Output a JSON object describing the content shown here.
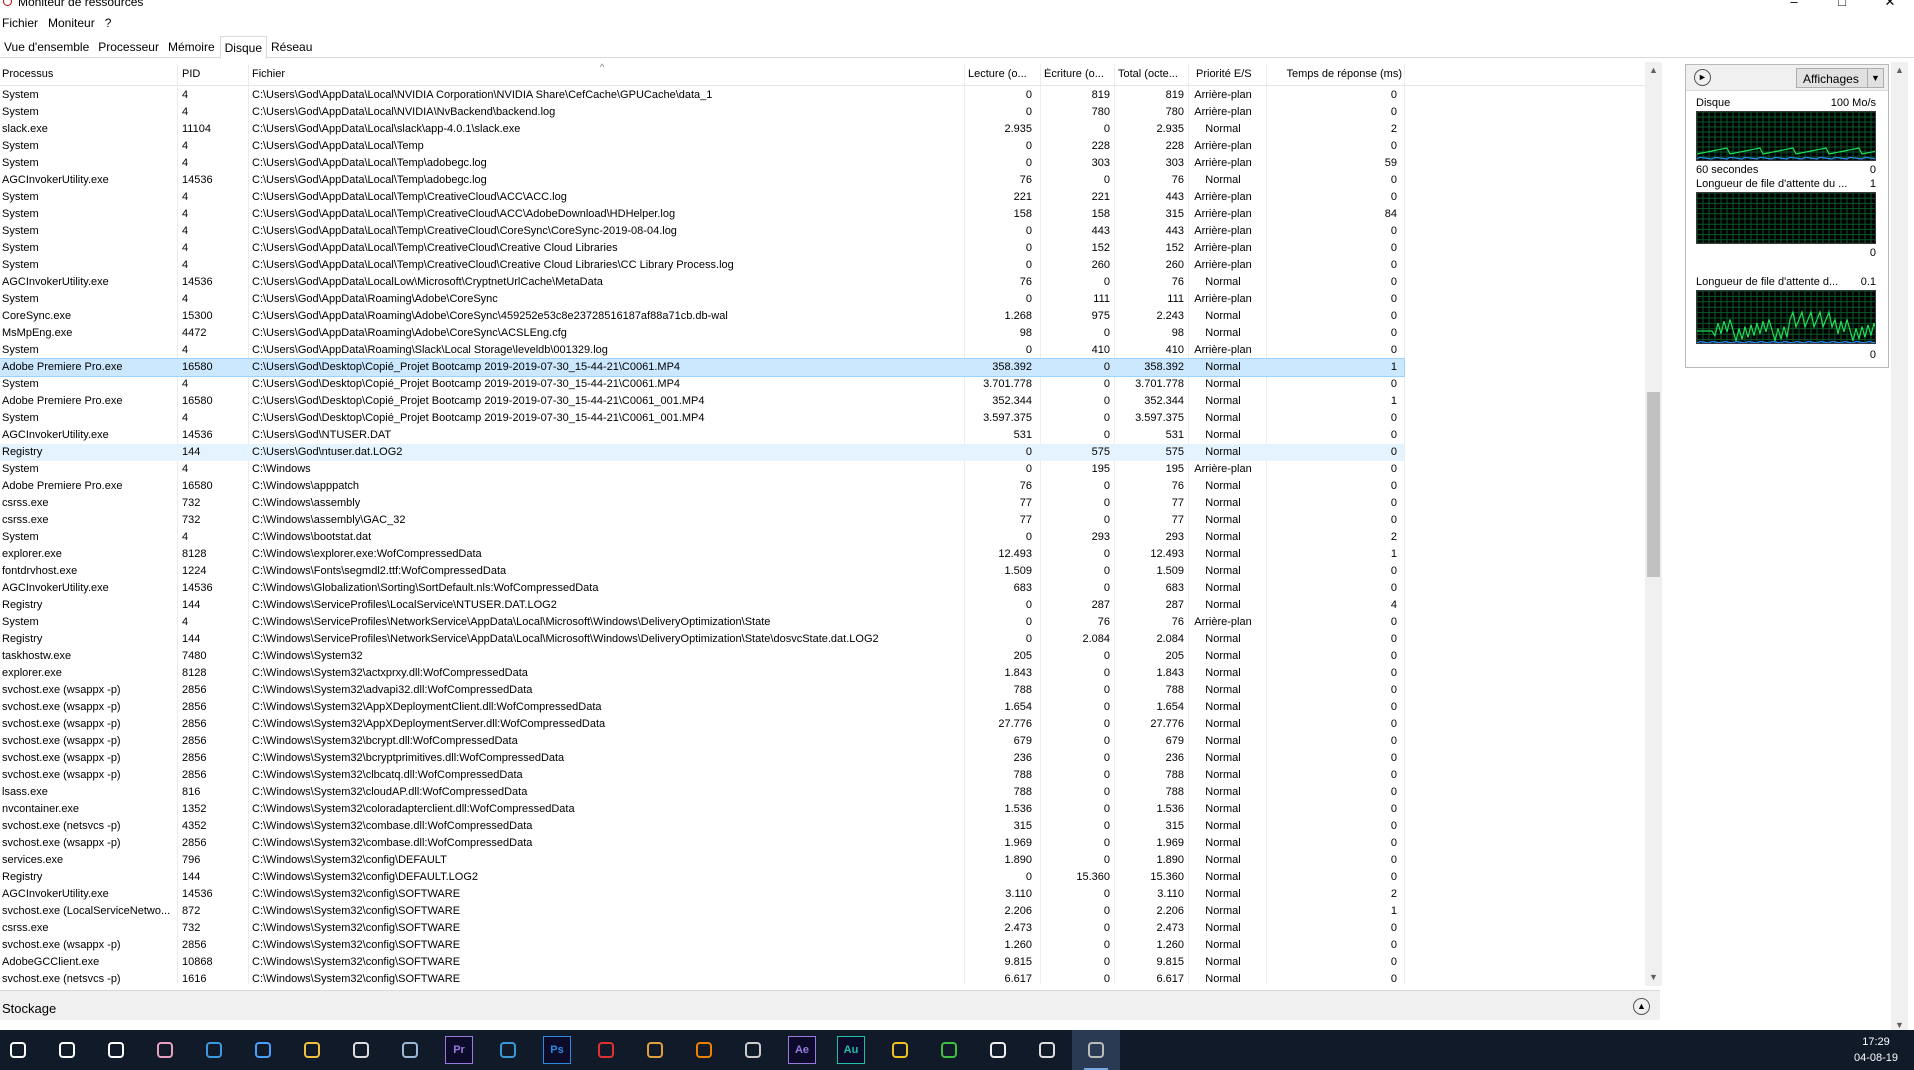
{
  "window": {
    "title": "Moniteur de ressources",
    "controls": [
      "–",
      "□",
      "✕"
    ]
  },
  "menu": [
    "Fichier",
    "Moniteur",
    "?"
  ],
  "tabs": [
    "Vue d'ensemble",
    "Processeur",
    "Mémoire",
    "Disque",
    "Réseau"
  ],
  "active_tab": "Disque",
  "columns": [
    "Processus",
    "PID",
    "Fichier",
    "Lecture (o...",
    "Écriture (o...",
    "Total (octe...",
    "Priorité E/S",
    "Temps de réponse (ms)"
  ],
  "rows": [
    [
      "System",
      "4",
      "C:\\Users\\God\\AppData\\Local\\NVIDIA Corporation\\NVIDIA Share\\CefCache\\GPUCache\\data_1",
      "0",
      "819",
      "819",
      "Arrière-plan",
      "0"
    ],
    [
      "System",
      "4",
      "C:\\Users\\God\\AppData\\Local\\NVIDIA\\NvBackend\\backend.log",
      "0",
      "780",
      "780",
      "Arrière-plan",
      "0"
    ],
    [
      "slack.exe",
      "11104",
      "C:\\Users\\God\\AppData\\Local\\slack\\app-4.0.1\\slack.exe",
      "2.935",
      "0",
      "2.935",
      "Normal",
      "2"
    ],
    [
      "System",
      "4",
      "C:\\Users\\God\\AppData\\Local\\Temp",
      "0",
      "228",
      "228",
      "Arrière-plan",
      "0"
    ],
    [
      "System",
      "4",
      "C:\\Users\\God\\AppData\\Local\\Temp\\adobegc.log",
      "0",
      "303",
      "303",
      "Arrière-plan",
      "59"
    ],
    [
      "AGCInvokerUtility.exe",
      "14536",
      "C:\\Users\\God\\AppData\\Local\\Temp\\adobegc.log",
      "76",
      "0",
      "76",
      "Normal",
      "0"
    ],
    [
      "System",
      "4",
      "C:\\Users\\God\\AppData\\Local\\Temp\\CreativeCloud\\ACC\\ACC.log",
      "221",
      "221",
      "443",
      "Arrière-plan",
      "0"
    ],
    [
      "System",
      "4",
      "C:\\Users\\God\\AppData\\Local\\Temp\\CreativeCloud\\ACC\\AdobeDownload\\HDHelper.log",
      "158",
      "158",
      "315",
      "Arrière-plan",
      "84"
    ],
    [
      "System",
      "4",
      "C:\\Users\\God\\AppData\\Local\\Temp\\CreativeCloud\\CoreSync\\CoreSync-2019-08-04.log",
      "0",
      "443",
      "443",
      "Arrière-plan",
      "0"
    ],
    [
      "System",
      "4",
      "C:\\Users\\God\\AppData\\Local\\Temp\\CreativeCloud\\Creative Cloud Libraries",
      "0",
      "152",
      "152",
      "Arrière-plan",
      "0"
    ],
    [
      "System",
      "4",
      "C:\\Users\\God\\AppData\\Local\\Temp\\CreativeCloud\\Creative Cloud Libraries\\CC Library Process.log",
      "0",
      "260",
      "260",
      "Arrière-plan",
      "0"
    ],
    [
      "AGCInvokerUtility.exe",
      "14536",
      "C:\\Users\\God\\AppData\\LocalLow\\Microsoft\\CryptnetUrlCache\\MetaData",
      "76",
      "0",
      "76",
      "Normal",
      "0"
    ],
    [
      "System",
      "4",
      "C:\\Users\\God\\AppData\\Roaming\\Adobe\\CoreSync",
      "0",
      "111",
      "111",
      "Arrière-plan",
      "0"
    ],
    [
      "CoreSync.exe",
      "15300",
      "C:\\Users\\God\\AppData\\Roaming\\Adobe\\CoreSync\\459252e53c8e23728516187af88a71cb.db-wal",
      "1.268",
      "975",
      "2.243",
      "Normal",
      "0"
    ],
    [
      "MsMpEng.exe",
      "4472",
      "C:\\Users\\God\\AppData\\Roaming\\Adobe\\CoreSync\\ACSLEng.cfg",
      "98",
      "0",
      "98",
      "Normal",
      "0"
    ],
    [
      "System",
      "4",
      "C:\\Users\\God\\AppData\\Roaming\\Slack\\Local Storage\\leveldb\\001329.log",
      "0",
      "410",
      "410",
      "Arrière-plan",
      "0"
    ],
    [
      "Adobe Premiere Pro.exe",
      "16580",
      "C:\\Users\\God\\Desktop\\Copié_Projet Bootcamp 2019-2019-07-30_15-44-21\\C0061.MP4",
      "358.392",
      "0",
      "358.392",
      "Normal",
      "1"
    ],
    [
      "System",
      "4",
      "C:\\Users\\God\\Desktop\\Copié_Projet Bootcamp 2019-2019-07-30_15-44-21\\C0061.MP4",
      "3.701.778",
      "0",
      "3.701.778",
      "Normal",
      "0"
    ],
    [
      "Adobe Premiere Pro.exe",
      "16580",
      "C:\\Users\\God\\Desktop\\Copié_Projet Bootcamp 2019-2019-07-30_15-44-21\\C0061_001.MP4",
      "352.344",
      "0",
      "352.344",
      "Normal",
      "1"
    ],
    [
      "System",
      "4",
      "C:\\Users\\God\\Desktop\\Copié_Projet Bootcamp 2019-2019-07-30_15-44-21\\C0061_001.MP4",
      "3.597.375",
      "0",
      "3.597.375",
      "Normal",
      "0"
    ],
    [
      "AGCInvokerUtility.exe",
      "14536",
      "C:\\Users\\God\\NTUSER.DAT",
      "531",
      "0",
      "531",
      "Normal",
      "0"
    ],
    [
      "Registry",
      "144",
      "C:\\Users\\God\\ntuser.dat.LOG2",
      "0",
      "575",
      "575",
      "Normal",
      "0"
    ],
    [
      "System",
      "4",
      "C:\\Windows",
      "0",
      "195",
      "195",
      "Arrière-plan",
      "0"
    ],
    [
      "Adobe Premiere Pro.exe",
      "16580",
      "C:\\Windows\\apppatch",
      "76",
      "0",
      "76",
      "Normal",
      "0"
    ],
    [
      "csrss.exe",
      "732",
      "C:\\Windows\\assembly",
      "77",
      "0",
      "77",
      "Normal",
      "0"
    ],
    [
      "csrss.exe",
      "732",
      "C:\\Windows\\assembly\\GAC_32",
      "77",
      "0",
      "77",
      "Normal",
      "0"
    ],
    [
      "System",
      "4",
      "C:\\Windows\\bootstat.dat",
      "0",
      "293",
      "293",
      "Normal",
      "2"
    ],
    [
      "explorer.exe",
      "8128",
      "C:\\Windows\\explorer.exe:WofCompressedData",
      "12.493",
      "0",
      "12.493",
      "Normal",
      "1"
    ],
    [
      "fontdrvhost.exe",
      "1224",
      "C:\\Windows\\Fonts\\segmdl2.ttf:WofCompressedData",
      "1.509",
      "0",
      "1.509",
      "Normal",
      "0"
    ],
    [
      "AGCInvokerUtility.exe",
      "14536",
      "C:\\Windows\\Globalization\\Sorting\\SortDefault.nls:WofCompressedData",
      "683",
      "0",
      "683",
      "Normal",
      "0"
    ],
    [
      "Registry",
      "144",
      "C:\\Windows\\ServiceProfiles\\LocalService\\NTUSER.DAT.LOG2",
      "0",
      "287",
      "287",
      "Normal",
      "4"
    ],
    [
      "System",
      "4",
      "C:\\Windows\\ServiceProfiles\\NetworkService\\AppData\\Local\\Microsoft\\Windows\\DeliveryOptimization\\State",
      "0",
      "76",
      "76",
      "Arrière-plan",
      "0"
    ],
    [
      "Registry",
      "144",
      "C:\\Windows\\ServiceProfiles\\NetworkService\\AppData\\Local\\Microsoft\\Windows\\DeliveryOptimization\\State\\dosvcState.dat.LOG2",
      "0",
      "2.084",
      "2.084",
      "Normal",
      "0"
    ],
    [
      "taskhostw.exe",
      "7480",
      "C:\\Windows\\System32",
      "205",
      "0",
      "205",
      "Normal",
      "0"
    ],
    [
      "explorer.exe",
      "8128",
      "C:\\Windows\\System32\\actxprxy.dll:WofCompressedData",
      "1.843",
      "0",
      "1.843",
      "Normal",
      "0"
    ],
    [
      "svchost.exe (wsappx -p)",
      "2856",
      "C:\\Windows\\System32\\advapi32.dll:WofCompressedData",
      "788",
      "0",
      "788",
      "Normal",
      "0"
    ],
    [
      "svchost.exe (wsappx -p)",
      "2856",
      "C:\\Windows\\System32\\AppXDeploymentClient.dll:WofCompressedData",
      "1.654",
      "0",
      "1.654",
      "Normal",
      "0"
    ],
    [
      "svchost.exe (wsappx -p)",
      "2856",
      "C:\\Windows\\System32\\AppXDeploymentServer.dll:WofCompressedData",
      "27.776",
      "0",
      "27.776",
      "Normal",
      "0"
    ],
    [
      "svchost.exe (wsappx -p)",
      "2856",
      "C:\\Windows\\System32\\bcrypt.dll:WofCompressedData",
      "679",
      "0",
      "679",
      "Normal",
      "0"
    ],
    [
      "svchost.exe (wsappx -p)",
      "2856",
      "C:\\Windows\\System32\\bcryptprimitives.dll:WofCompressedData",
      "236",
      "0",
      "236",
      "Normal",
      "0"
    ],
    [
      "svchost.exe (wsappx -p)",
      "2856",
      "C:\\Windows\\System32\\clbcatq.dll:WofCompressedData",
      "788",
      "0",
      "788",
      "Normal",
      "0"
    ],
    [
      "lsass.exe",
      "816",
      "C:\\Windows\\System32\\cloudAP.dll:WofCompressedData",
      "788",
      "0",
      "788",
      "Normal",
      "0"
    ],
    [
      "nvcontainer.exe",
      "1352",
      "C:\\Windows\\System32\\coloradapterclient.dll:WofCompressedData",
      "1.536",
      "0",
      "1.536",
      "Normal",
      "0"
    ],
    [
      "svchost.exe (netsvcs -p)",
      "4352",
      "C:\\Windows\\System32\\combase.dll:WofCompressedData",
      "315",
      "0",
      "315",
      "Normal",
      "0"
    ],
    [
      "svchost.exe (wsappx -p)",
      "2856",
      "C:\\Windows\\System32\\combase.dll:WofCompressedData",
      "1.969",
      "0",
      "1.969",
      "Normal",
      "0"
    ],
    [
      "services.exe",
      "796",
      "C:\\Windows\\System32\\config\\DEFAULT",
      "1.890",
      "0",
      "1.890",
      "Normal",
      "0"
    ],
    [
      "Registry",
      "144",
      "C:\\Windows\\System32\\config\\DEFAULT.LOG2",
      "0",
      "15.360",
      "15.360",
      "Normal",
      "0"
    ],
    [
      "AGCInvokerUtility.exe",
      "14536",
      "C:\\Windows\\System32\\config\\SOFTWARE",
      "3.110",
      "0",
      "3.110",
      "Normal",
      "2"
    ],
    [
      "svchost.exe (LocalServiceNetwo...",
      "872",
      "C:\\Windows\\System32\\config\\SOFTWARE",
      "2.206",
      "0",
      "2.206",
      "Normal",
      "1"
    ],
    [
      "csrss.exe",
      "732",
      "C:\\Windows\\System32\\config\\SOFTWARE",
      "2.473",
      "0",
      "2.473",
      "Normal",
      "0"
    ],
    [
      "svchost.exe (wsappx -p)",
      "2856",
      "C:\\Windows\\System32\\config\\SOFTWARE",
      "1.260",
      "0",
      "1.260",
      "Normal",
      "0"
    ],
    [
      "AdobeGCClient.exe",
      "10868",
      "C:\\Windows\\System32\\config\\SOFTWARE",
      "9.815",
      "0",
      "9.815",
      "Normal",
      "0"
    ],
    [
      "svchost.exe (netsvcs -p)",
      "1616",
      "C:\\Windows\\System32\\config\\SOFTWARE",
      "6.617",
      "0",
      "6.617",
      "Normal",
      "0"
    ]
  ],
  "selected_row": 16,
  "hover_row": 21,
  "storage": {
    "label": "Stockage"
  },
  "side": {
    "view_label": "Affichages",
    "disk": {
      "title": "Disque",
      "scale": "100 Mo/s",
      "footer_left": "60 secondes",
      "footer_right": "0"
    },
    "queue1": {
      "title": "Longueur de file d'attente du ...",
      "scale": "1",
      "footer_right": "0"
    },
    "queue2": {
      "title": "Longueur de file d'attente d...",
      "scale": "0.1",
      "footer_right": "0"
    }
  },
  "colors": {
    "graph_bg": "#000000",
    "graph_grid": "#0a5a2a",
    "graph_line": "#1ee05a",
    "graph_line2": "#2b8cff",
    "selection": "#cce8ff",
    "taskbar": "#101a28"
  },
  "taskbar": {
    "icons": [
      "windows-start-icon",
      "search-icon",
      "task-view-icon",
      "chrome-canary-icon",
      "edge-icon",
      "store-icon",
      "file-explorer-icon",
      "mail-icon",
      "steam-icon",
      "premiere-pro-icon",
      "messenger-icon",
      "photoshop-icon",
      "creative-cloud-icon",
      "slack-icon",
      "vlc-icon",
      "video-editor-icon",
      "after-effects-icon",
      "audition-icon",
      "chrome-icon",
      "chrome-alt-icon",
      "settings-icon",
      "controller-icon",
      "resource-monitor-icon"
    ],
    "labels": {
      "premiere-pro-icon": "Pr",
      "photoshop-icon": "Ps",
      "after-effects-icon": "Ae",
      "audition-icon": "Au"
    },
    "time": "17:29",
    "date": "04-08-19"
  }
}
